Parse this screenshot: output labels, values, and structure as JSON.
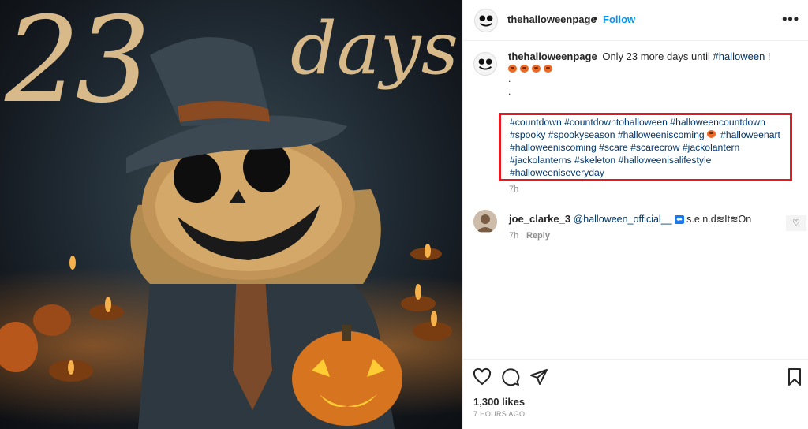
{
  "media": {
    "overlay_number": "23",
    "overlay_word": "days"
  },
  "post": {
    "username": "thehalloweenpage",
    "separator": "•",
    "follow_label": "Follow",
    "more_label": "•••"
  },
  "caption": {
    "username": "thehalloweenpage",
    "text": "Only 23 more days until",
    "hashtag": "#halloween",
    "suffix": " !",
    "dot1": ".",
    "dot2": ".",
    "hashtags": [
      "#countdown",
      "#countdowntohalloween",
      "#halloweencountdown",
      "#spooky",
      "#spookyseason",
      "#halloweeniscoming",
      "#halloweenart",
      "#halloweeniscoming",
      "#scare",
      "#scarecrow",
      "#jackolantern",
      "#jackolanterns",
      "#skeleton",
      "#halloweenisalifestyle",
      "#halloweeniseveryday"
    ],
    "time": "7h"
  },
  "comment": {
    "username": "joe_clarke_3",
    "mention": "@halloween_official__",
    "badge": "⬅",
    "text": "s.e.n.d≋It≋On",
    "time": "7h",
    "reply_label": "Reply",
    "like_icon": "heart-icon"
  },
  "footer": {
    "likes": "1,300 likes",
    "time_ago": "7 HOURS AGO"
  },
  "colors": {
    "accent": "#0095f6",
    "highlight_border": "#e21b22",
    "hashtag": "#00376b"
  }
}
